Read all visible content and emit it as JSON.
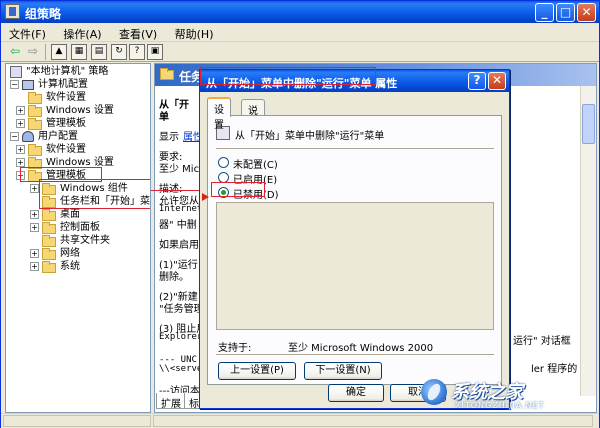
{
  "window": {
    "title": "组策略"
  },
  "menubar": [
    "文件(F)",
    "操作(A)",
    "查看(V)",
    "帮助(H)"
  ],
  "tree": {
    "root": "\"本地计算机\" 策略",
    "computer_config": "计算机配置",
    "c_software": "软件设置",
    "c_windows": "Windows 设置",
    "c_admin": "管理模板",
    "user_config": "用户配置",
    "u_software": "软件设置",
    "u_windows": "Windows 设置",
    "u_admin": "管理模板",
    "win_components": "Windows 组件",
    "taskbar_start": "任务栏和「开始」菜",
    "desktop": "桌面",
    "control_panel": "控制面板",
    "shared_folders": "共享文件夹",
    "network": "网络",
    "system": "系统"
  },
  "right_pane": {
    "header": "任务栏和「开始」菜单",
    "lines": [
      "从「开",
      "单",
      "显示",
      "属性",
      "要求:",
      "至少 Micr",
      "描述:",
      "允许您从",
      "Internet",
      "器\" 中删",
      "如果启用该",
      "(1)\"运行",
      "删除。",
      "(2)\"新建",
      "\"任务管理",
      "(3) 阻止用",
      "Explorer",
      "--- UNC 路",
      "\\\\<server",
      "---访问本",
      "运行\" 对话框",
      "ler 程序的"
    ],
    "tabs": [
      "扩展",
      "标准"
    ]
  },
  "dialog": {
    "title": "从「开始」菜单中删除\"运行\"菜单 属性",
    "tabs": [
      "设置",
      "说明"
    ],
    "policy_name": "从「开始」菜单中删除\"运行\"菜单",
    "radios": [
      {
        "label": "未配置(C)",
        "checked": false
      },
      {
        "label": "已启用(E)",
        "checked": false
      },
      {
        "label": "已禁用(D)",
        "checked": true
      }
    ],
    "support_label": "支持于:",
    "support_value": "至少 Microsoft Windows 2000",
    "prev_button": "上一设置(P)",
    "next_button": "下一设置(N)",
    "ok_button": "确定",
    "cancel_button": "取消"
  },
  "watermark": {
    "brand": "系统之家",
    "url": "XITONGZHIJIA.NET"
  },
  "colors": {
    "accent": "#0b5fe8",
    "highlight": "#d22233",
    "face": "#ece9d8"
  }
}
